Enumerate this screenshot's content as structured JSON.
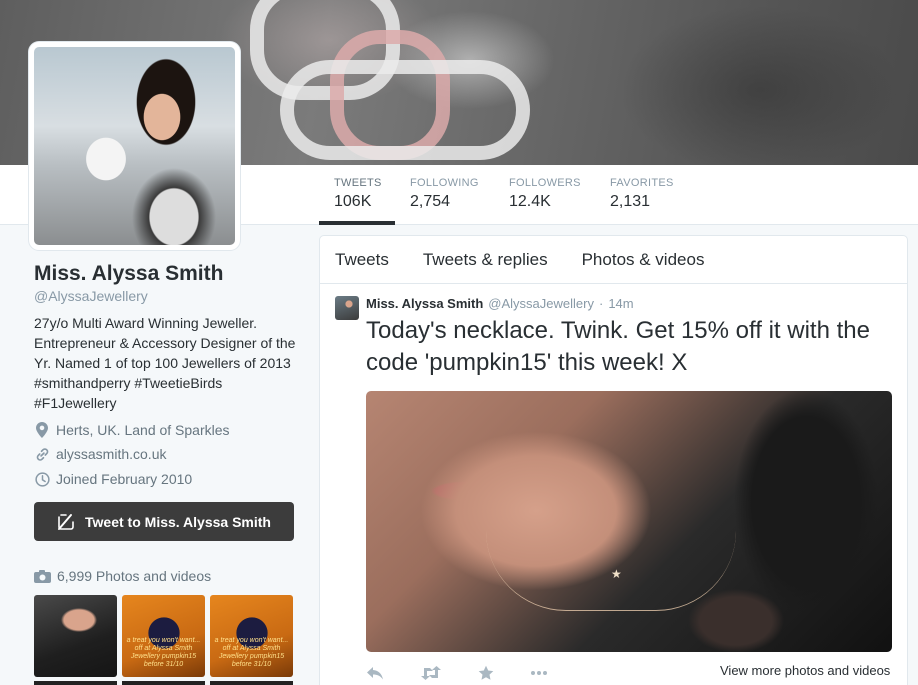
{
  "profile": {
    "name": "Miss. Alyssa Smith",
    "handle": "@AlyssaJewellery",
    "bio": "27y/o Multi Award Winning Jeweller. Entrepreneur & Accessory Designer of the Yr. Named 1 of top 100 Jewellers of 2013 #smithandperry #TweetieBirds #F1Jewellery",
    "location": "Herts, UK. Land of Sparkles",
    "website": "alyssasmith.co.uk",
    "joined": "Joined February 2010",
    "tweet_to_label": "Tweet to Miss. Alyssa Smith",
    "photos_label": "6,999 Photos and videos",
    "thumb_caption": "a treat you won't want... off at Alyssa Smith Jewellery pumpkin15 before 31/10"
  },
  "stats": [
    {
      "label": "TWEETS",
      "value": "106K"
    },
    {
      "label": "FOLLOWING",
      "value": "2,754"
    },
    {
      "label": "FOLLOWERS",
      "value": "12.4K"
    },
    {
      "label": "FAVORITES",
      "value": "2,131"
    }
  ],
  "tabs": [
    "Tweets",
    "Tweets & replies",
    "Photos & videos"
  ],
  "tweet": {
    "name": "Miss. Alyssa Smith",
    "handle": "@AlyssaJewellery",
    "time": "14m",
    "text": "Today's necklace. Twink. Get 15% off it with the code 'pumpkin15' this week! X",
    "view_more": "View more photos and videos"
  },
  "icons": {
    "location": "map-pin-icon",
    "website": "link-icon",
    "joined": "clock-icon",
    "tweet_to": "compose-icon",
    "photos": "camera-icon",
    "reply": "reply-icon",
    "retweet": "retweet-icon",
    "favorite": "star-icon",
    "more": "more-icon"
  }
}
